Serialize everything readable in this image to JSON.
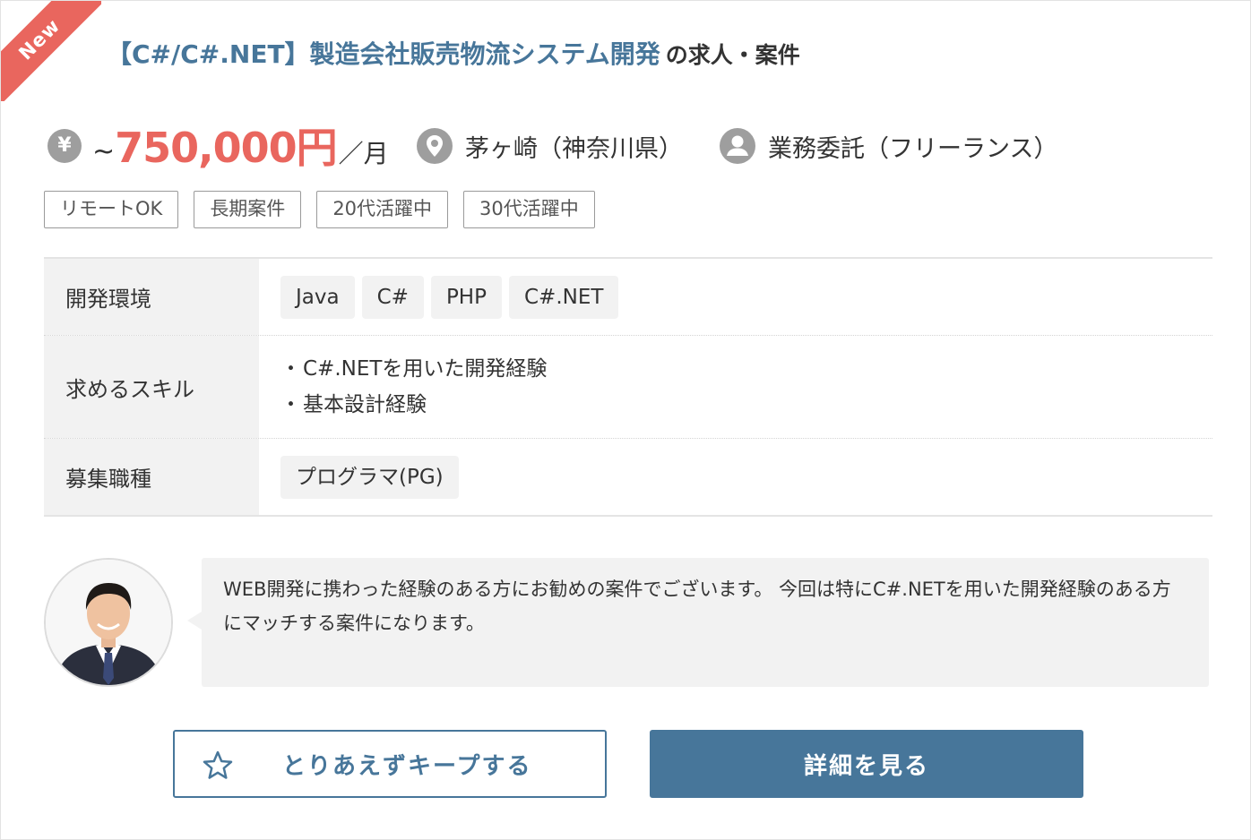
{
  "badge": "New",
  "title": {
    "job": "【C#/C#.NET】製造会社販売物流システム開発",
    "suffix": "の求人・案件"
  },
  "info": {
    "yen_symbol": "¥",
    "tilde": "~",
    "salary": "750,000円",
    "salary_unit": "／月",
    "location": "茅ヶ崎（神奈川県）",
    "contract": "業務委託（フリーランス）"
  },
  "tags": [
    "リモートOK",
    "長期案件",
    "20代活躍中",
    "30代活躍中"
  ],
  "details": {
    "env_label": "開発環境",
    "env": [
      "Java",
      "C#",
      "PHP",
      "C#.NET"
    ],
    "skills_label": "求めるスキル",
    "skills": [
      "C#.NETを用いた開発経験",
      "基本設計経験"
    ],
    "role_label": "募集職種",
    "role": "プログラマ(PG)"
  },
  "comment": "WEB開発に携わった経験のある方にお勧めの案件でございます。 今回は特にC#.NETを用いた開発経験のある方にマッチする案件になります。",
  "buttons": {
    "keep": "とりあえずキープする",
    "detail": "詳細を見る"
  },
  "colors": {
    "accent": "#47769a",
    "salary": "#e9665e",
    "ribbon": "#e9665e",
    "icon_gray": "#9e9e9e"
  },
  "icons": [
    "yen-icon",
    "location-pin-icon",
    "user-icon",
    "star-icon"
  ]
}
